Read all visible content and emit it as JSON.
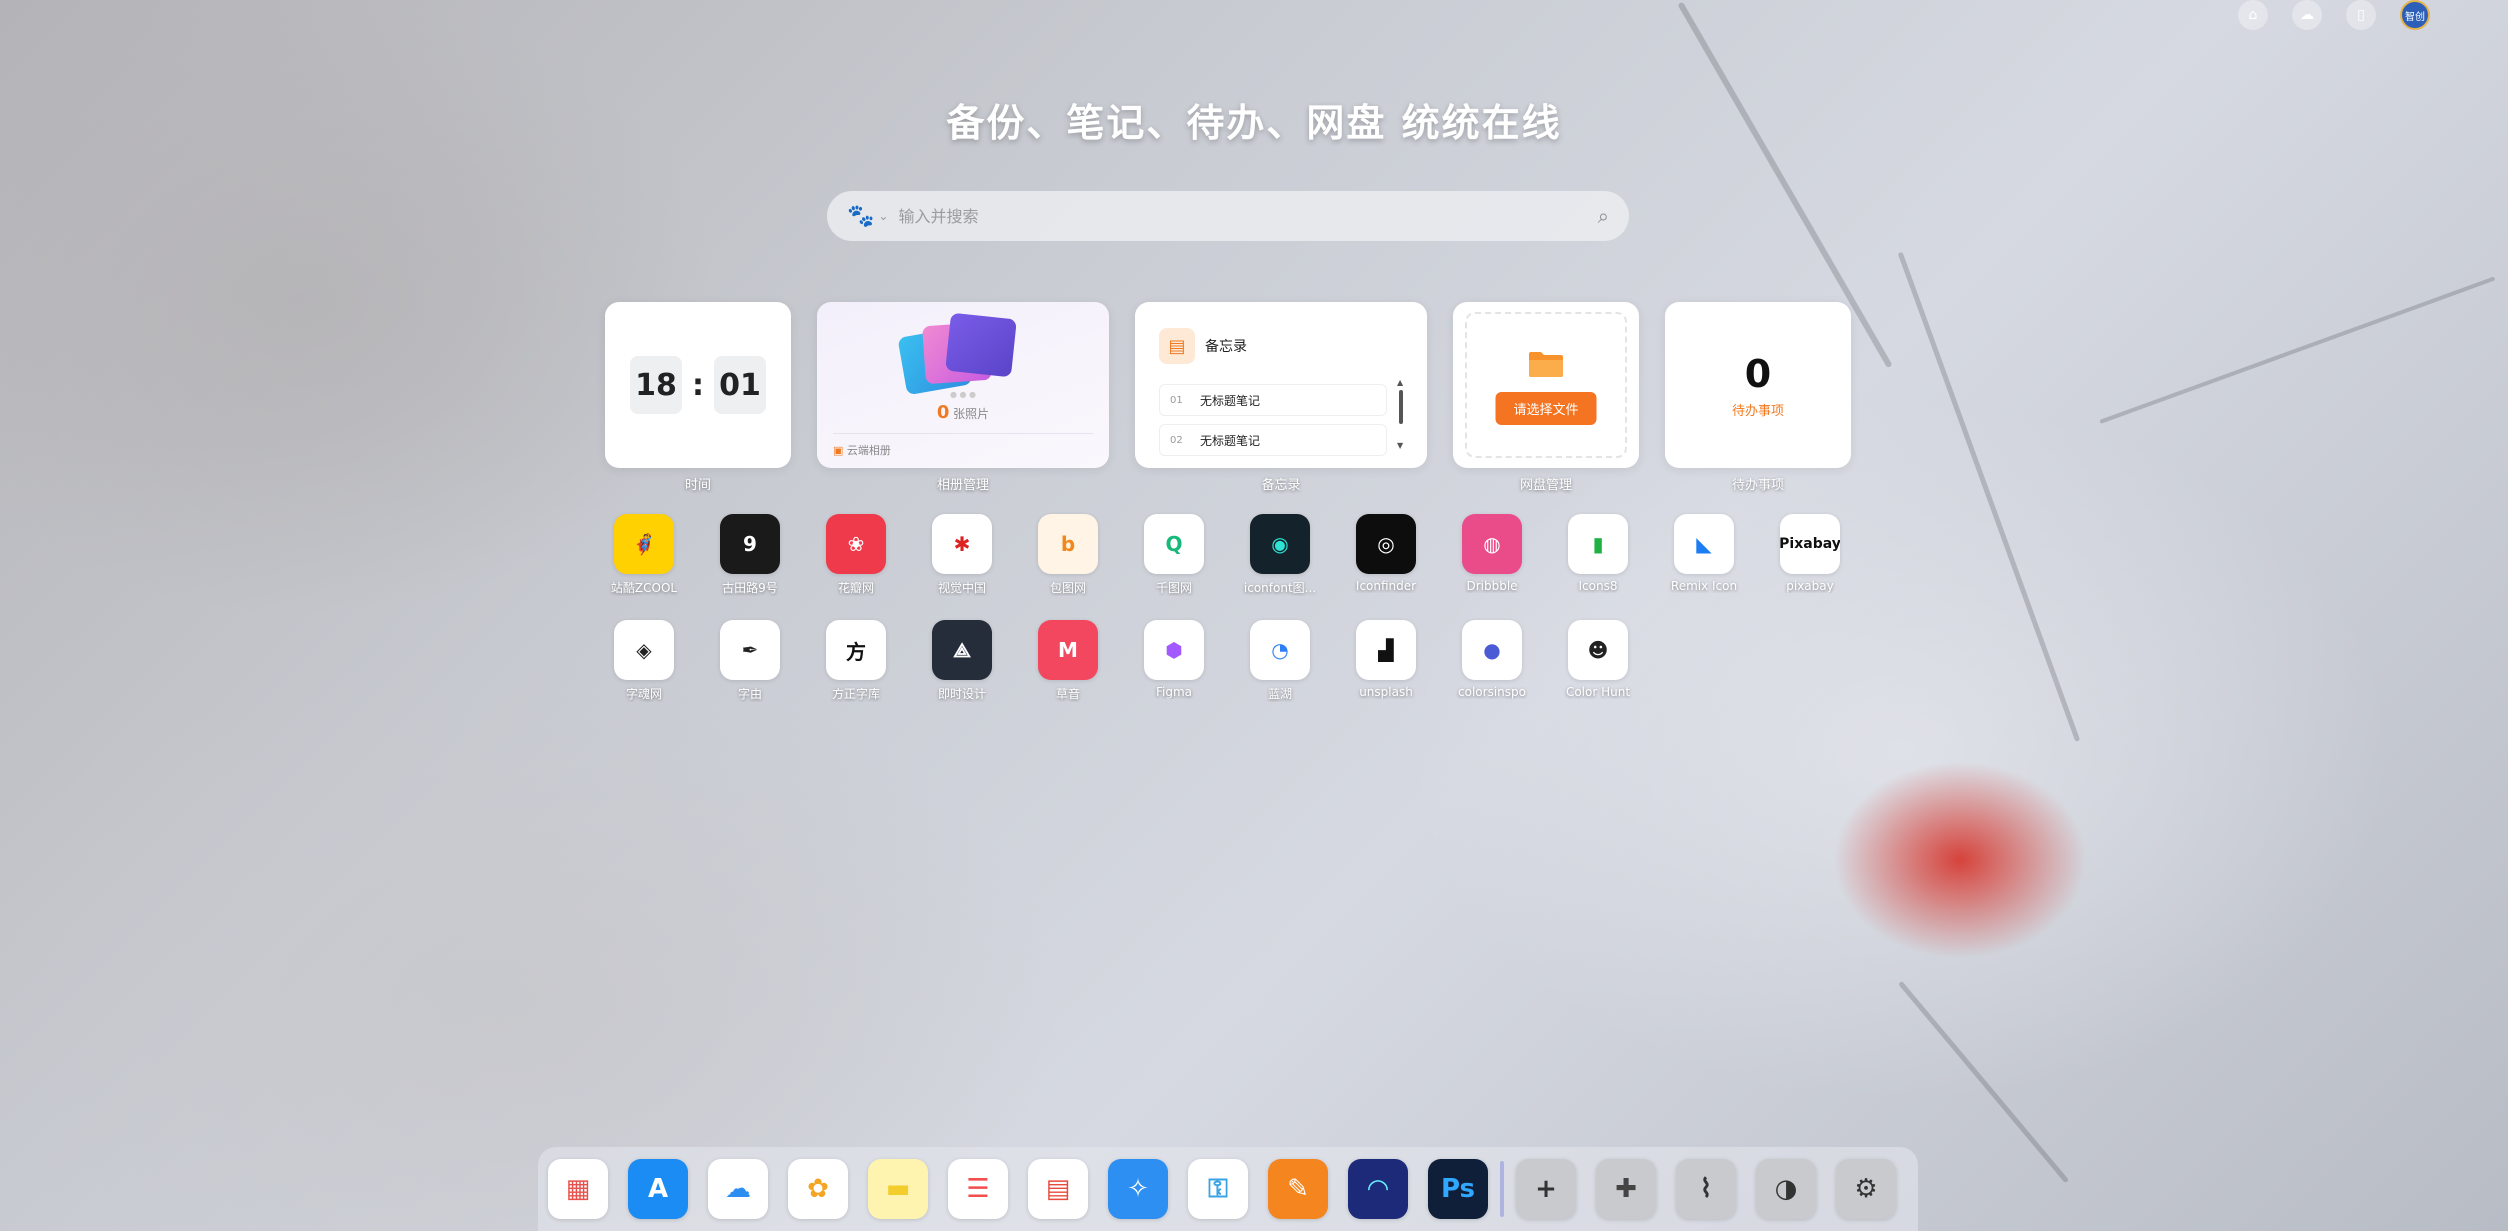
{
  "top_bar": {
    "icons": [
      "home-icon",
      "cloud-icon",
      "sidebar-icon"
    ],
    "avatar_text": "智创"
  },
  "headline": "备份、笔记、待办、网盘 统统在线",
  "search": {
    "engine_icon": "baidu-paw-icon",
    "placeholder": "输入并搜索",
    "value": ""
  },
  "widgets": {
    "clock": {
      "hour": "18",
      "minute": "01",
      "label": "时间"
    },
    "album": {
      "count": "0",
      "count_unit": "张照片",
      "footer": "云端相册",
      "label": "相册管理"
    },
    "memo": {
      "title": "备忘录",
      "notes": [
        {
          "index": "01",
          "title": "无标题笔记"
        },
        {
          "index": "02",
          "title": "无标题笔记"
        }
      ],
      "label": "备忘录"
    },
    "disk": {
      "button": "请选择文件",
      "label": "网盘管理"
    },
    "todo": {
      "count": "0",
      "text": "待办事项",
      "label": "待办事项"
    }
  },
  "apps": [
    {
      "name": "站酷ZCOOL",
      "glyph": "🦸",
      "bg": "#ffd100",
      "fg": "#111"
    },
    {
      "name": "古田路9号",
      "glyph": "9",
      "bg": "#1a1a1a",
      "fg": "#fff"
    },
    {
      "name": "花瓣网",
      "glyph": "❀",
      "bg": "#ef3a4b",
      "fg": "#fff"
    },
    {
      "name": "视觉中国",
      "glyph": "✱",
      "bg": "#ffffff",
      "fg": "#d22"
    },
    {
      "name": "包图网",
      "glyph": "b",
      "bg": "#fff4e5",
      "fg": "#f0881e"
    },
    {
      "name": "千图网",
      "glyph": "Q",
      "bg": "#ffffff",
      "fg": "#17b979"
    },
    {
      "name": "iconfont图...",
      "glyph": "◉",
      "bg": "#14232b",
      "fg": "#2de3d3"
    },
    {
      "name": "Iconfinder",
      "glyph": "◎",
      "bg": "#0d0d0d",
      "fg": "#fff"
    },
    {
      "name": "Dribbble",
      "glyph": "◍",
      "bg": "#ea4c89",
      "fg": "#fff"
    },
    {
      "name": "Icons8",
      "glyph": "▮",
      "bg": "#ffffff",
      "fg": "#1fb141"
    },
    {
      "name": "Remix Icon",
      "glyph": "◣",
      "bg": "#ffffff",
      "fg": "#1c7cf4"
    },
    {
      "name": "pixabay",
      "glyph": "Pixabay",
      "bg": "#ffffff",
      "fg": "#111"
    },
    {
      "name": "字魂网",
      "glyph": "◈",
      "bg": "#ffffff",
      "fg": "#222"
    },
    {
      "name": "字由",
      "glyph": "✒",
      "bg": "#ffffff",
      "fg": "#222"
    },
    {
      "name": "方正字库",
      "glyph": "方",
      "bg": "#ffffff",
      "fg": "#111"
    },
    {
      "name": "即时设计",
      "glyph": "⟁",
      "bg": "#252d3b",
      "fg": "#fff"
    },
    {
      "name": "草音",
      "glyph": "M",
      "bg": "#f2475f",
      "fg": "#fff"
    },
    {
      "name": "Figma",
      "glyph": "⬢",
      "bg": "#ffffff",
      "fg": "#a259ff"
    },
    {
      "name": "蓝湖",
      "glyph": "◔",
      "bg": "#ffffff",
      "fg": "#2c7ff6"
    },
    {
      "name": "unsplash",
      "glyph": "▟",
      "bg": "#ffffff",
      "fg": "#111"
    },
    {
      "name": "colorsinspo",
      "glyph": "●",
      "bg": "#ffffff",
      "fg": "#4b5bd6"
    },
    {
      "name": "Color Hunt",
      "glyph": "☻",
      "bg": "#ffffff",
      "fg": "#222"
    }
  ],
  "dock": [
    {
      "name": "launchpad-icon",
      "glyph": "▦",
      "bg": "#ffffff",
      "fg": "#e8514b"
    },
    {
      "name": "app-store-icon",
      "glyph": "A",
      "bg": "#1a8cf3",
      "fg": "#fff"
    },
    {
      "name": "icloud-icon",
      "glyph": "☁",
      "bg": "#ffffff",
      "fg": "#2d8ef2"
    },
    {
      "name": "photos-icon",
      "glyph": "✿",
      "bg": "#ffffff",
      "fg": "#f5a524"
    },
    {
      "name": "notes-icon",
      "glyph": "▬",
      "bg": "#fff3b0",
      "fg": "#f3cd2c"
    },
    {
      "name": "reminders-icon",
      "glyph": "☰",
      "bg": "#ffffff",
      "fg": "#f24e4e"
    },
    {
      "name": "calendar-icon",
      "glyph": "▤",
      "bg": "#ffffff",
      "fg": "#e84b3c"
    },
    {
      "name": "safari-icon",
      "glyph": "✧",
      "bg": "#2e8ff3",
      "fg": "#fff"
    },
    {
      "name": "keychain-icon",
      "glyph": "⚿",
      "bg": "#ffffff",
      "fg": "#3aa3e6"
    },
    {
      "name": "sketch-tool-icon",
      "glyph": "✎",
      "bg": "#f5851f",
      "fg": "#fff"
    },
    {
      "name": "gauge-app-icon",
      "glyph": "◠",
      "bg": "#1d2a7a",
      "fg": "#6ef"
    },
    {
      "name": "photoshop-icon",
      "glyph": "Ps",
      "bg": "#0f1f3a",
      "fg": "#31a8ff"
    },
    {
      "name": "add-icon",
      "glyph": "+",
      "bg": "#c8cace",
      "fg": "#333"
    },
    {
      "name": "extensions-icon",
      "glyph": "✚",
      "bg": "#c8cace",
      "fg": "#444"
    },
    {
      "name": "brush-icon",
      "glyph": "⌇",
      "bg": "#c8cace",
      "fg": "#333"
    },
    {
      "name": "screen-time-icon",
      "glyph": "◑",
      "bg": "#c8cace",
      "fg": "#333"
    },
    {
      "name": "settings-gear-icon",
      "glyph": "⚙",
      "bg": "#c8cace",
      "fg": "#333"
    }
  ]
}
